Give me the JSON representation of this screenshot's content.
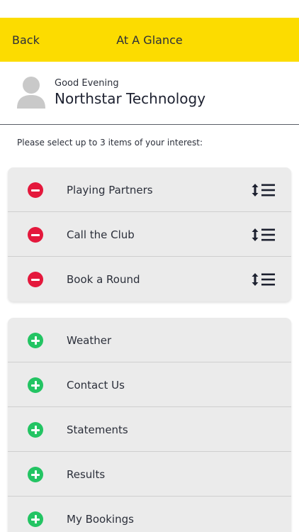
{
  "header": {
    "back_label": "Back",
    "title": "At A Glance",
    "background": "#fcdc00"
  },
  "profile": {
    "greeting": "Good Evening",
    "company": "Northstar Technology",
    "avatar_icon": "user-avatar-icon"
  },
  "prompt": "Please select up to 3 items of your interest:",
  "selected_items": [
    {
      "label": "Playing Partners",
      "icon": "remove-circle-icon",
      "handle_icon": "reorder-icon"
    },
    {
      "label": "Call the Club",
      "icon": "remove-circle-icon",
      "handle_icon": "reorder-icon"
    },
    {
      "label": "Book a Round",
      "icon": "remove-circle-icon",
      "handle_icon": "reorder-icon"
    }
  ],
  "available_items": [
    {
      "label": "Weather",
      "icon": "add-circle-icon"
    },
    {
      "label": "Contact Us",
      "icon": "add-circle-icon"
    },
    {
      "label": "Statements",
      "icon": "add-circle-icon"
    },
    {
      "label": "Results",
      "icon": "add-circle-icon"
    },
    {
      "label": "My Bookings",
      "icon": "add-circle-icon"
    }
  ],
  "colors": {
    "remove": "#e4183c",
    "add": "#23c463",
    "card": "#ebebeb",
    "text": "#2b2f3a"
  }
}
